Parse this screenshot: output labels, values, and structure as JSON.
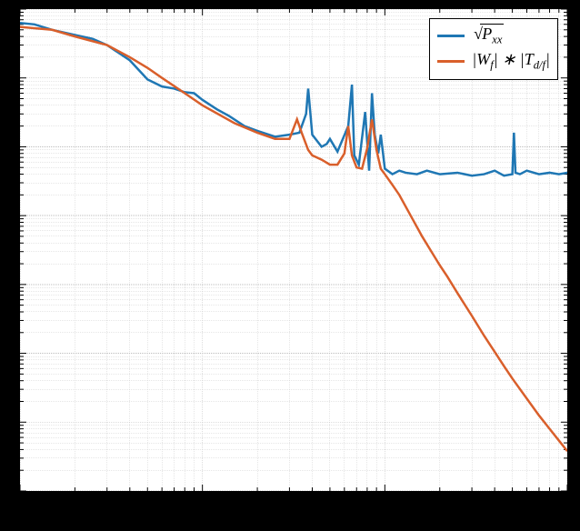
{
  "chart_data": {
    "type": "line",
    "title": "",
    "xlabel": "",
    "ylabel": "",
    "xscale": "log",
    "yscale": "log",
    "xlim": [
      1,
      1000
    ],
    "ylim": [
      1e-09,
      0.01
    ],
    "grid": {
      "major": true,
      "minor": true
    },
    "legend": {
      "position": "upper right",
      "border": true
    },
    "series": [
      {
        "name": "sqrt(P_xx)",
        "label_tex": "\\sqrt{P_{xx}}",
        "color": "#1f77b4",
        "x": [
          1,
          1.2,
          1.5,
          2,
          2.5,
          3,
          4,
          5,
          6,
          7,
          8,
          9,
          10,
          12,
          14,
          17,
          20,
          25,
          30,
          34,
          37,
          38,
          40,
          45,
          48,
          50,
          55,
          63,
          66,
          68,
          72,
          78,
          82,
          85,
          88,
          92,
          95,
          100,
          110,
          120,
          130,
          150,
          170,
          200,
          250,
          300,
          350,
          400,
          450,
          500,
          510,
          520,
          550,
          600,
          700,
          800,
          900,
          1000
        ],
        "y": [
          0.0063,
          0.006,
          0.005,
          0.0042,
          0.0037,
          0.003,
          0.0018,
          0.00095,
          0.00075,
          0.0007,
          0.00062,
          0.0006,
          0.00048,
          0.00035,
          0.00028,
          0.0002,
          0.00017,
          0.00014,
          0.00015,
          0.00016,
          0.0003,
          0.0007,
          0.00015,
          0.0001,
          0.00011,
          0.00013,
          8.5e-05,
          0.0002,
          0.0008,
          7.5e-05,
          5.5e-05,
          0.00032,
          4.5e-05,
          0.0006,
          0.00015,
          8e-05,
          0.00015,
          4.8e-05,
          4e-05,
          4.5e-05,
          4.2e-05,
          4e-05,
          4.5e-05,
          4e-05,
          4.2e-05,
          3.8e-05,
          4e-05,
          4.5e-05,
          3.8e-05,
          4e-05,
          0.00016,
          4.2e-05,
          4e-05,
          4.5e-05,
          4e-05,
          4.2e-05,
          4e-05,
          4.2e-05
        ]
      },
      {
        "name": "|W_f|*|T_{d/f}|",
        "label_tex": "|W_f| * |T_{d/f}|",
        "color": "#d95f2b",
        "x": [
          1,
          1.5,
          2,
          3,
          4,
          5,
          6,
          8,
          10,
          15,
          20,
          25,
          30,
          33,
          35,
          38,
          40,
          45,
          50,
          55,
          60,
          63,
          66,
          70,
          75,
          80,
          85,
          90,
          95,
          100,
          110,
          120,
          140,
          160,
          180,
          200,
          220,
          250,
          300,
          350,
          400,
          450,
          500,
          600,
          700,
          800,
          900,
          1000
        ],
        "y": [
          0.0055,
          0.005,
          0.004,
          0.003,
          0.002,
          0.0014,
          0.001,
          0.0006,
          0.0004,
          0.00022,
          0.00016,
          0.00013,
          0.00013,
          0.00025,
          0.00016,
          9e-05,
          7.5e-05,
          6.5e-05,
          5.5e-05,
          5.5e-05,
          8e-05,
          0.0002,
          7.5e-05,
          5e-05,
          4.8e-05,
          9.5e-05,
          0.00025,
          9e-05,
          4.8e-05,
          4e-05,
          2.8e-05,
          2e-05,
          9.5e-06,
          5e-06,
          3e-06,
          1.9e-06,
          1.3e-06,
          7.5e-07,
          3.5e-07,
          1.8e-07,
          1.05e-07,
          6.5e-08,
          4.3e-08,
          2.2e-08,
          1.25e-08,
          8e-09,
          5.4e-09,
          3.8e-09
        ]
      }
    ]
  },
  "legend_labels": {
    "s1_html": "<span class='sqrt'><span class='radicand'>P<sub>xx</sub></span></span>",
    "s2_html": "|W<sub>f</sub>| ∗ |T<sub>d/f</sub>|"
  }
}
